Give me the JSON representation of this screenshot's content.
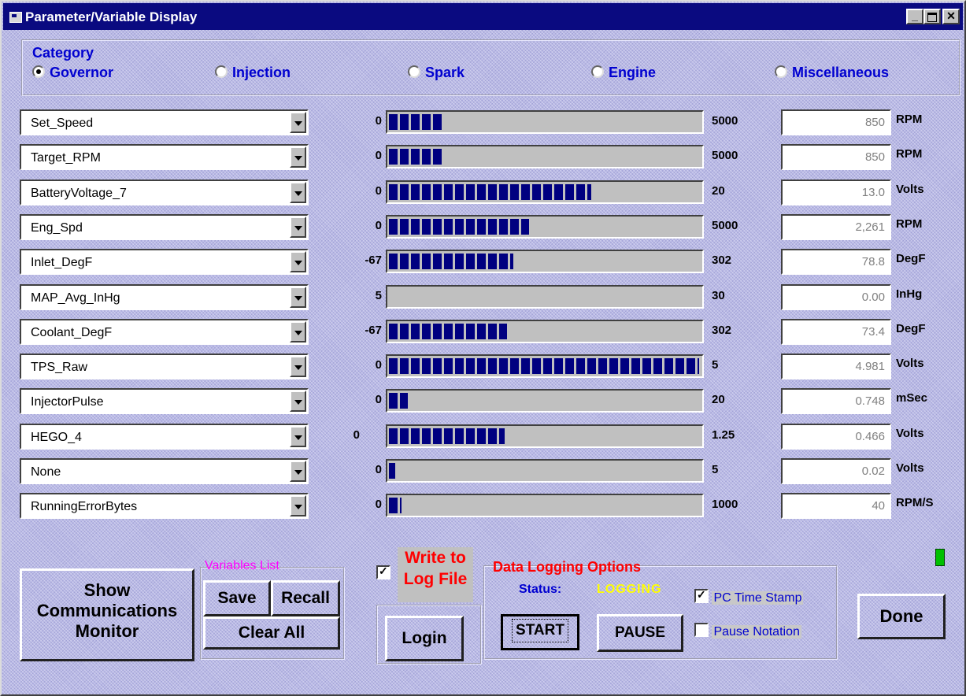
{
  "window": {
    "title": "Parameter/Variable Display"
  },
  "category": {
    "title": "Category",
    "options": [
      {
        "label": "Governor",
        "selected": true
      },
      {
        "label": "Injection",
        "selected": false
      },
      {
        "label": "Spark",
        "selected": false
      },
      {
        "label": "Engine",
        "selected": false
      },
      {
        "label": "Miscellaneous",
        "selected": false
      }
    ]
  },
  "rows": [
    {
      "name": "Set_Speed",
      "min": "0",
      "max": "5000",
      "value": "850",
      "unit": "RPM",
      "fill": 0.17
    },
    {
      "name": "Target_RPM",
      "min": "0",
      "max": "5000",
      "value": "850",
      "unit": "RPM",
      "fill": 0.17
    },
    {
      "name": "BatteryVoltage_7",
      "min": "0",
      "max": "20",
      "value": "13.0",
      "unit": "Volts",
      "fill": 0.65
    },
    {
      "name": "Eng_Spd",
      "min": "0",
      "max": "5000",
      "value": "2,261",
      "unit": "RPM",
      "fill": 0.45
    },
    {
      "name": "Inlet_DegF",
      "min": "-67",
      "max": "302",
      "value": "78.8",
      "unit": "DegF",
      "fill": 0.4
    },
    {
      "name": "MAP_Avg_InHg",
      "min": "5",
      "max": "30",
      "value": "0.00",
      "unit": "InHg",
      "fill": 0.0
    },
    {
      "name": "Coolant_DegF",
      "min": "-67",
      "max": "302",
      "value": "73.4",
      "unit": "DegF",
      "fill": 0.38
    },
    {
      "name": "TPS_Raw",
      "min": "0",
      "max": "5",
      "value": "4.981",
      "unit": "Volts",
      "fill": 0.996
    },
    {
      "name": "InjectorPulse",
      "min": "0",
      "max": "20",
      "value": "0.748",
      "unit": "mSec",
      "fill": 0.06
    },
    {
      "name": "HEGO_4",
      "min": "0",
      "max": "1.25",
      "value": "0.466",
      "unit": "Volts",
      "fill": 0.37
    },
    {
      "name": "None",
      "min": "0",
      "max": "5",
      "value": "0.02",
      "unit": "Volts",
      "fill": 0.02
    },
    {
      "name": "RunningErrorBytes",
      "min": "0",
      "max": "1000",
      "value": "40",
      "unit": "RPM/S",
      "fill": 0.04
    }
  ],
  "buttons": {
    "show_comm_line1": "Show",
    "show_comm_line2": "Communications",
    "show_comm_line3": "Monitor",
    "save": "Save",
    "recall": "Recall",
    "clear_all": "Clear All",
    "login": "Login",
    "start": "START",
    "pause": "PAUSE",
    "done": "Done"
  },
  "variables_list": {
    "title": "Variables List"
  },
  "log": {
    "write_line1": "Write to",
    "write_line2": "Log File",
    "write_checked": true,
    "options_title": "Data Logging Options",
    "status_label": "Status:",
    "status_value": "LOGGING",
    "pc_time_stamp": "PC Time Stamp",
    "pc_time_stamp_checked": true,
    "pause_notation": "Pause Notation",
    "pause_notation_checked": false
  },
  "colors": {
    "titlebar": "#0a0a80",
    "accent_blue": "#0000d0",
    "log_red": "#ff0000",
    "magenta": "#ff00ff",
    "status_yellow": "#ffff00",
    "bar_fill": "#000080",
    "indicator_green": "#00c000"
  }
}
